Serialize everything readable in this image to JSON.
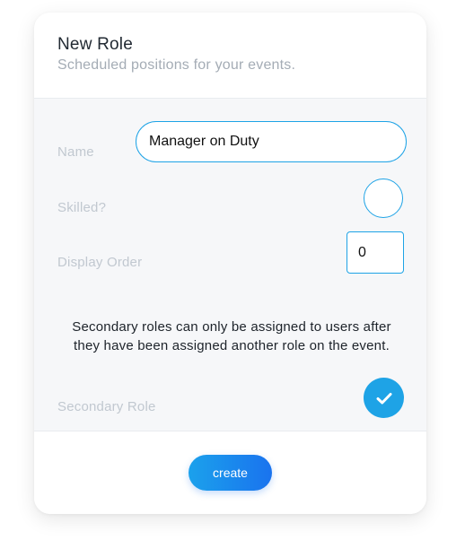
{
  "header": {
    "title": "New Role",
    "subtitle": "Scheduled positions for your events."
  },
  "form": {
    "name": {
      "label": "Name",
      "value": "Manager on Duty"
    },
    "skilled": {
      "label": "Skilled?",
      "checked": false
    },
    "display_order": {
      "label": "Display Order",
      "value": "0"
    },
    "secondary_note": "Secondary roles can only be assigned to users after they have been assigned another role on the event.",
    "secondary_role": {
      "label": "Secondary Role",
      "checked": true
    }
  },
  "footer": {
    "create_label": "create"
  },
  "colors": {
    "accent": "#1ea3e6",
    "button_gradient_start": "#1ba1ec",
    "button_gradient_end": "#1a73ee",
    "label": "#c1c8d0",
    "body_bg": "#f6f7f9"
  },
  "icons": {
    "secondary_role_toggle": "checkmark-icon"
  }
}
